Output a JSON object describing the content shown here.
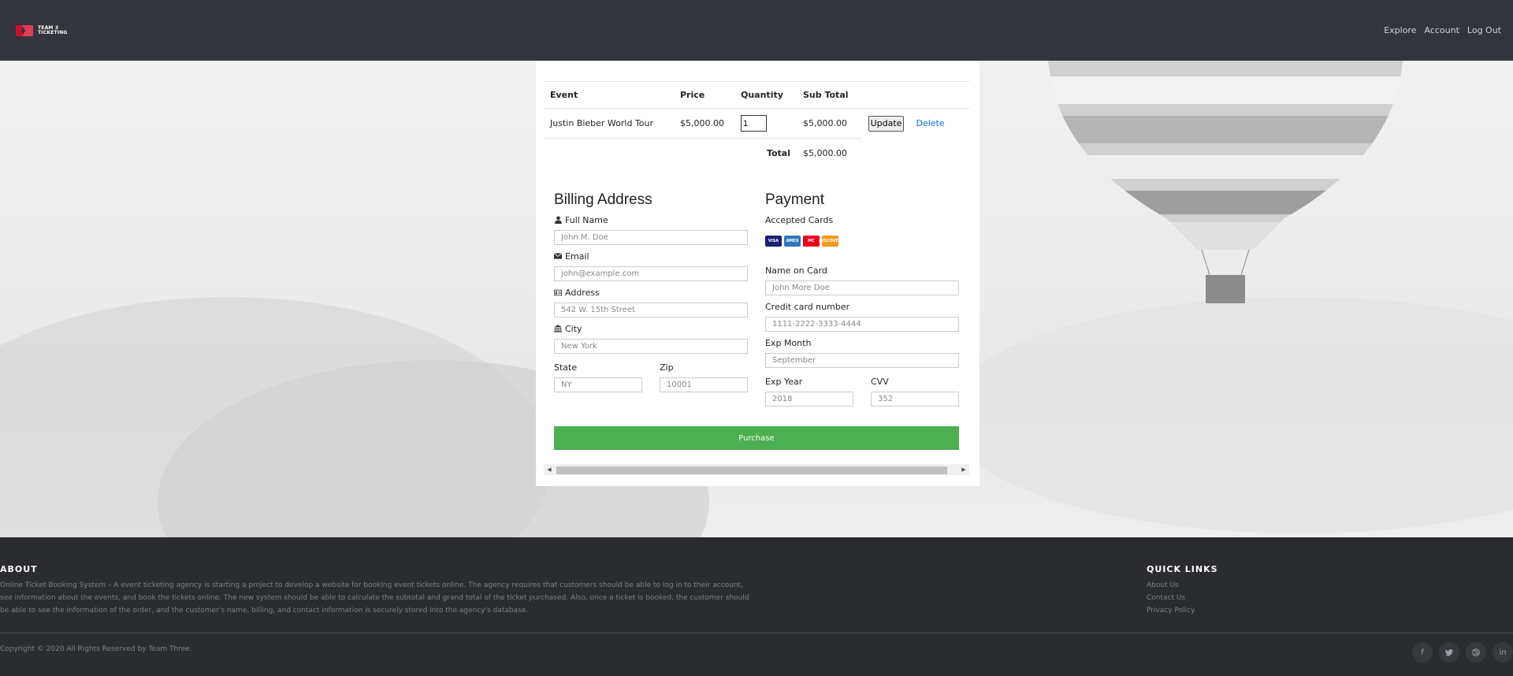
{
  "header": {
    "logo_text_line1": "TEAM 3",
    "logo_text_line2": "TICKETING",
    "nav": [
      "Explore",
      "Account",
      "Log Out"
    ]
  },
  "cart": {
    "headers": [
      "Event",
      "Price",
      "Quantity",
      "Sub Total"
    ],
    "item": {
      "event": "Justin Bieber World Tour",
      "price": "$5,000.00",
      "quantity": "1",
      "subtotal": "$5,000.00",
      "update_label": "Update",
      "delete_label": "Delete"
    },
    "total_label": "Total",
    "total_value": "$5,000.00"
  },
  "billing": {
    "title": "Billing Address",
    "full_name_label": "Full Name",
    "full_name_placeholder": "John M. Doe",
    "email_label": "Email",
    "email_placeholder": "john@example.com",
    "address_label": "Address",
    "address_placeholder": "542 W. 15th Street",
    "city_label": "City",
    "city_placeholder": "New York",
    "state_label": "State",
    "state_placeholder": "NY",
    "zip_label": "Zip",
    "zip_placeholder": "10001"
  },
  "payment": {
    "title": "Payment",
    "accepted_label": "Accepted Cards",
    "cards": [
      {
        "name": "VISA",
        "color": "#1a1f71"
      },
      {
        "name": "AMEX",
        "color": "#2e77bb"
      },
      {
        "name": "MC",
        "color": "#eb001b"
      },
      {
        "name": "DISCOVER",
        "color": "#f29a1a"
      }
    ],
    "name_label": "Name on Card",
    "name_placeholder": "John More Doe",
    "cc_label": "Credit card number",
    "cc_placeholder": "1111-2222-3333-4444",
    "exp_month_label": "Exp Month",
    "exp_month_placeholder": "September",
    "exp_year_label": "Exp Year",
    "exp_year_placeholder": "2018",
    "cvv_label": "CVV",
    "cvv_placeholder": "352"
  },
  "purchase_label": "Purchase",
  "footer": {
    "about_title": "ABOUT",
    "about_text": "Online Ticket Booking System – A event ticketing agency is starting a project to develop a website for booking event tickets online. The agency requires that customers should be able to log in to their account, see information about the events, and book the tickets online. The new system should be able to calculate the subtotal and grand total of the ticket purchased. Also, once a ticket is booked, the customer should be able to see the information of the order, and the customer's name, billing, and contact information is securely stored into the agency's database.",
    "links_title": "QUICK LINKS",
    "links": [
      "About Us",
      "Contact Us",
      "Privacy Policy"
    ],
    "copyright": "Copyright © 2020 All Rights Reserved by Team Three.",
    "social_icons": [
      "facebook-icon",
      "twitter-icon",
      "dribbble-icon",
      "linkedin-icon"
    ]
  },
  "colors": {
    "header_bg": "#32353b",
    "footer_bg": "#2a2c30",
    "purchase_green": "#4caf50",
    "link_blue": "#0d6efd"
  }
}
